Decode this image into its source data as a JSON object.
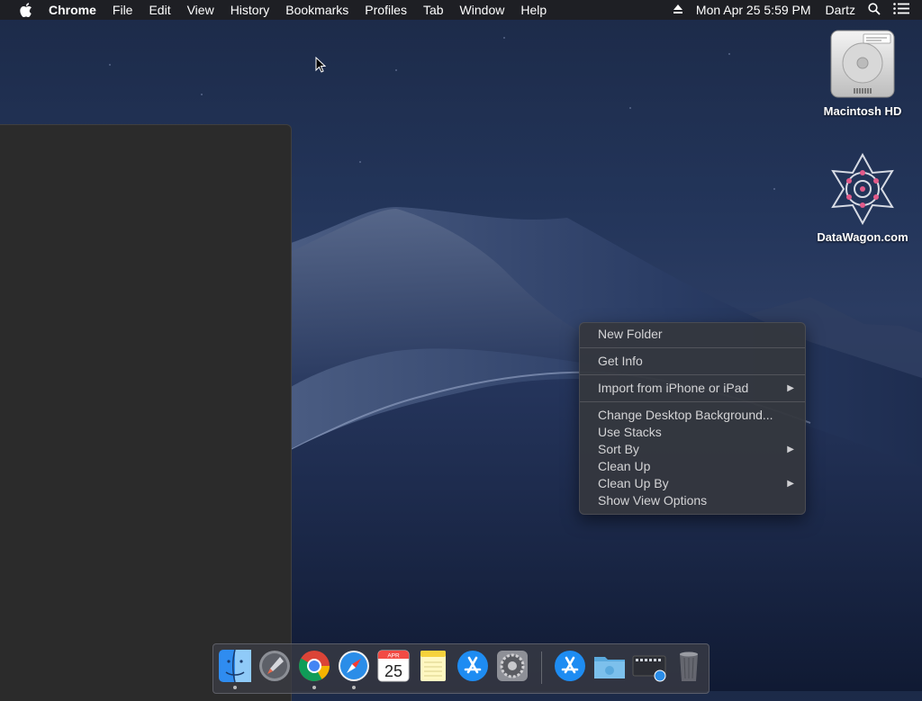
{
  "menubar": {
    "app_name": "Chrome",
    "items": [
      "File",
      "Edit",
      "View",
      "History",
      "Bookmarks",
      "Profiles",
      "Tab",
      "Window",
      "Help"
    ],
    "clock": "Mon Apr 25  5:59 PM",
    "user": "Dartz",
    "icons": [
      "apple-icon",
      "eject-icon",
      "search-icon",
      "list-icon"
    ]
  },
  "desktop": {
    "icons": [
      {
        "label": "Macintosh HD",
        "icon": "hard-drive-icon"
      },
      {
        "label": "DataWagon.com",
        "icon": "datawagon-logo-icon"
      }
    ]
  },
  "context_menu": {
    "items": [
      {
        "label": "New Folder"
      },
      {
        "label": "Get Info"
      },
      {
        "label": "Import from iPhone or iPad",
        "submenu": true
      },
      {
        "label": "Change Desktop Background..."
      },
      {
        "label": "Use Stacks"
      },
      {
        "label": "Sort By",
        "submenu": true
      },
      {
        "label": "Clean Up"
      },
      {
        "label": "Clean Up By",
        "submenu": true
      },
      {
        "label": "Show View Options"
      }
    ]
  },
  "dock": {
    "calendar": {
      "month": "APR",
      "day": "25"
    },
    "apps": [
      "finder-icon",
      "launchpad-icon",
      "chrome-icon",
      "safari-icon",
      "calendar-icon",
      "notes-icon",
      "app-store-icon",
      "system-preferences-icon",
      "app-store-download-icon",
      "downloads-folder-icon",
      "screenshot-app-icon",
      "trash-icon"
    ],
    "running": [
      "finder-icon",
      "chrome-icon",
      "safari-icon"
    ]
  },
  "colors": {
    "menubar_bg": "#1e1e22",
    "window_bg": "#2b2b2b",
    "context_menu_bg": "#34373e",
    "desktop_bg": "#1f2f52"
  }
}
